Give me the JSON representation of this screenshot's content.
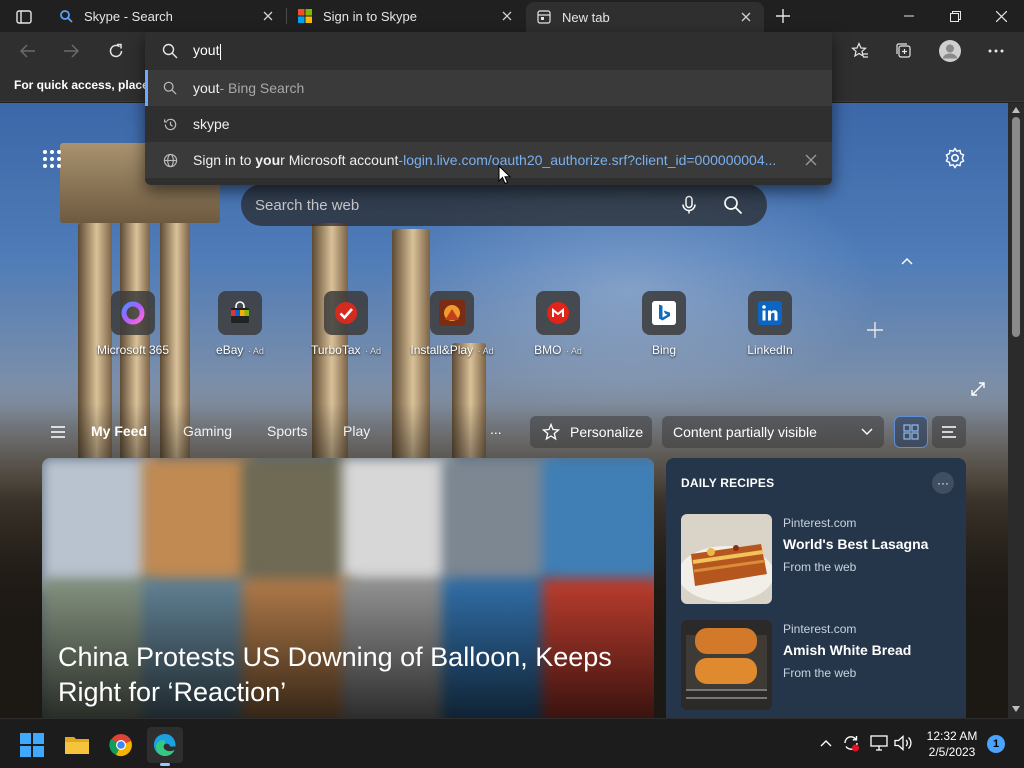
{
  "tabs": [
    {
      "title": "Skype - Search",
      "icon": "bing-search-icon"
    },
    {
      "title": "Sign in to Skype",
      "icon": "microsoft-logo-icon"
    },
    {
      "title": "New tab",
      "icon": "new-tab-page-icon",
      "active": true
    }
  ],
  "address": {
    "value": "yout"
  },
  "suggestions": [
    {
      "text": "yout",
      "suffix": " - Bing Search",
      "icon": "search-icon"
    },
    {
      "text": "skype",
      "icon": "history-icon"
    },
    {
      "prefix": "Sign in to ",
      "bold": "you",
      "rest": "r Microsoft account",
      "sep": " - ",
      "url": "login.live.com/oauth20_authorize.srf?client_id=000000004...",
      "icon": "globe-icon"
    }
  ],
  "favorites_hint": "For quick access, place y",
  "newtab": {
    "search_placeholder": "Search the web",
    "quicklinks": [
      {
        "label": "Microsoft 365",
        "ad": ""
      },
      {
        "label": "eBay",
        "ad": "Ad"
      },
      {
        "label": "TurboTax",
        "ad": "Ad"
      },
      {
        "label": "Install&Play",
        "ad": "Ad"
      },
      {
        "label": "BMO",
        "ad": "Ad"
      },
      {
        "label": "Bing",
        "ad": ""
      },
      {
        "label": "LinkedIn",
        "ad": ""
      }
    ],
    "feed_nav": [
      "My Feed",
      "Gaming",
      "Sports",
      "Play"
    ],
    "more": "...",
    "personalize": "Personalize",
    "visibility": "Content partially visible",
    "hero_title": "China Protests US Downing of Balloon, Keeps Right for ‘Reaction’",
    "recipes": {
      "title": "DAILY RECIPES",
      "more": "···",
      "items": [
        {
          "source": "Pinterest.com",
          "name": "World's Best Lasagna",
          "from": "From the web"
        },
        {
          "source": "Pinterest.com",
          "name": "Amish White Bread",
          "from": "From the web"
        }
      ]
    }
  },
  "taskbar": {
    "time": "12:32 AM",
    "date": "2/5/2023",
    "notifications": "1"
  },
  "colors": {
    "accent": "#6fa8ff",
    "url": "#79b1f2",
    "toolbar": "#2f2f2f"
  }
}
